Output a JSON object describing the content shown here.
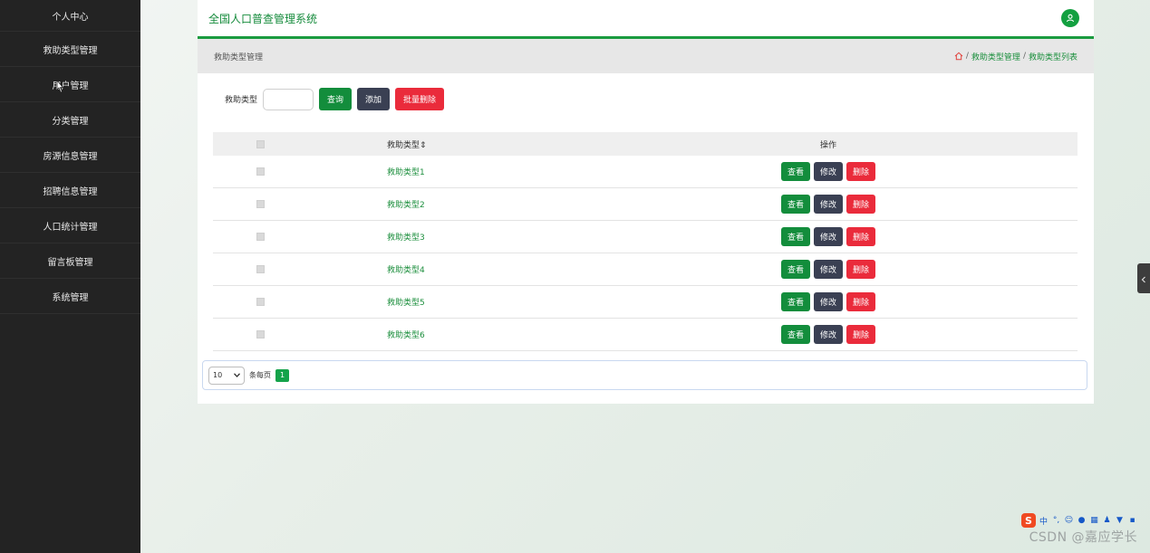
{
  "sidebar": {
    "items": [
      {
        "label": "个人中心"
      },
      {
        "label": "救助类型管理"
      },
      {
        "label": "用户管理"
      },
      {
        "label": "分类管理"
      },
      {
        "label": "房源信息管理"
      },
      {
        "label": "招聘信息管理"
      },
      {
        "label": "人口统计管理"
      },
      {
        "label": "留言板管理"
      },
      {
        "label": "系统管理"
      }
    ]
  },
  "header": {
    "app_title": "全国人口普查管理系统",
    "user_icon": "user-avatar-icon"
  },
  "breadcrumb": {
    "page_title": "救助类型管理",
    "home_icon": "home-icon",
    "sep1": "/",
    "crumb1": "救助类型管理",
    "sep2": "/",
    "crumb2": "救助类型列表"
  },
  "search": {
    "label": "救助类型",
    "value": "",
    "query_button": "查询",
    "add_button": "添加",
    "batch_delete_button": "批量删除"
  },
  "table": {
    "columns": [
      "",
      "救助类型",
      "操作"
    ],
    "sort_icon": "⇕",
    "rows": [
      {
        "name": "救助类型1"
      },
      {
        "name": "救助类型2"
      },
      {
        "name": "救助类型3"
      },
      {
        "name": "救助类型4"
      },
      {
        "name": "救助类型5"
      },
      {
        "name": "救助类型6"
      }
    ],
    "actions": {
      "view": "查看",
      "edit": "修改",
      "delete": "删除"
    }
  },
  "pagination": {
    "page_size": "10",
    "per_page_label": "条每页",
    "current_page": "1"
  },
  "colors": {
    "accent": "#138d3c",
    "sidebar_bg": "#232323",
    "danger": "#ea2b3b",
    "dark_button": "#3a4053"
  },
  "watermark": "CSDN @嘉应学长",
  "tray": {
    "ime": "中"
  }
}
